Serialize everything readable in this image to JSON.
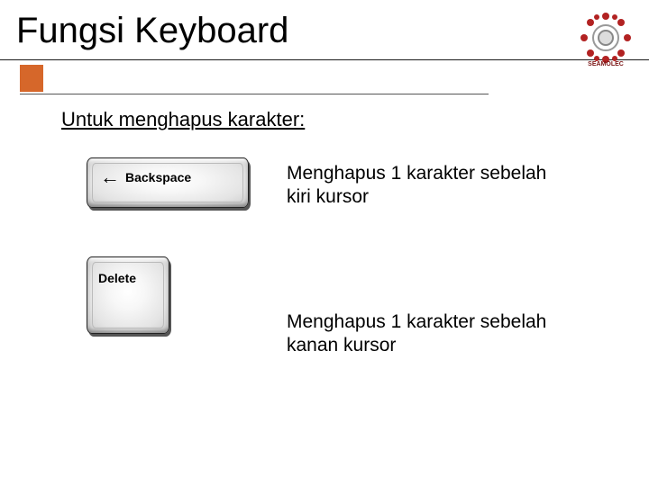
{
  "title": "Fungsi Keyboard",
  "subtitle": "Untuk menghapus karakter:",
  "logo": {
    "name": "seamolec-logo",
    "text": "SEAMOLEC",
    "accent": "#B22222"
  },
  "keys": [
    {
      "name": "backspace",
      "arrow": "←",
      "label": "Backspace",
      "description": "Menghapus 1 karakter sebelah kiri kursor"
    },
    {
      "name": "delete",
      "label": "Delete",
      "description": "Menghapus 1 karakter sebelah kanan kursor"
    }
  ]
}
